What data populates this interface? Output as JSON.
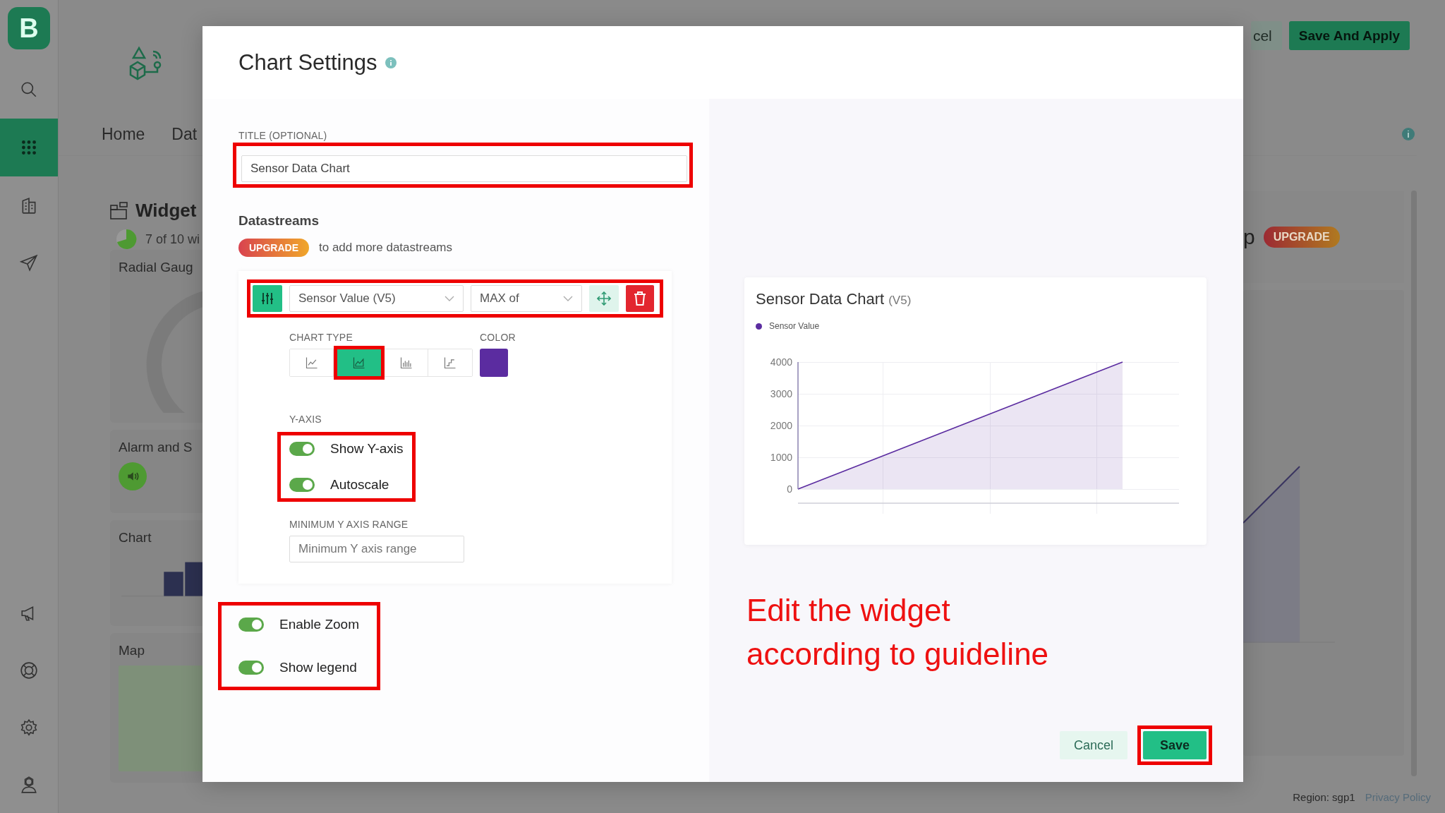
{
  "sidebar": {
    "logo": "B",
    "items": [
      {
        "kind": "search",
        "selected": false
      },
      {
        "kind": "grid",
        "selected": true
      },
      {
        "kind": "building",
        "selected": false
      },
      {
        "kind": "send",
        "selected": false
      },
      {
        "kind": "megaphone",
        "selected": false
      },
      {
        "kind": "lifebuoy",
        "selected": false
      },
      {
        "kind": "gear",
        "selected": false
      },
      {
        "kind": "user",
        "selected": false
      }
    ]
  },
  "header": {
    "buttons": [
      {
        "kind": "secondary",
        "label": "cel"
      },
      {
        "kind": "primary",
        "label": "Save And Apply"
      }
    ]
  },
  "nav": {
    "tabs": [
      {
        "label": "Home"
      },
      {
        "label": "Dat"
      }
    ]
  },
  "widgets": {
    "title": "Widget",
    "count": "7 of 10 wi",
    "cards": [
      {
        "kind": "gauge",
        "title": "Radial Gaug"
      },
      {
        "kind": "alarm",
        "title": "Alarm and S"
      },
      {
        "kind": "chart",
        "title": "Chart"
      },
      {
        "kind": "map",
        "title": "Map"
      }
    ]
  },
  "right_panel": {
    "card_text": "p",
    "badge": "UPGRADE"
  },
  "footer": {
    "region": "Region: sgp1",
    "link": "Privacy Policy"
  },
  "dialog": {
    "title": "Chart Settings",
    "title_field": {
      "label": "TITLE (OPTIONAL)",
      "value": "Sensor Data Chart",
      "highlighted": true
    },
    "datastreams": {
      "heading": "Datastreams",
      "upgrade_badge": "UPGRADE",
      "upgrade_note": "to add more datastreams",
      "row": {
        "datastream": "Sensor Value (V5)",
        "aggregation": "MAX of",
        "highlighted": true
      },
      "chart_type": {
        "label": "CHART TYPE",
        "options": [
          {
            "kind": "line",
            "selected": false,
            "highlighted": false
          },
          {
            "kind": "area",
            "selected": true,
            "highlighted": true
          },
          {
            "kind": "bar",
            "selected": false,
            "highlighted": false
          },
          {
            "kind": "step",
            "selected": false,
            "highlighted": false
          }
        ]
      },
      "color": {
        "label": "COLOR",
        "color": "#5b2ca0"
      },
      "y_axis": {
        "label": "Y-AXIS",
        "highlighted": true,
        "toggles": [
          {
            "label": "Show Y-axis",
            "on": true
          },
          {
            "label": "Autoscale",
            "on": true
          }
        ]
      },
      "min_range": {
        "label": "MINIMUM Y AXIS RANGE",
        "placeholder": "Minimum Y axis range"
      }
    },
    "options": {
      "highlighted": true,
      "toggles": [
        {
          "label": "Enable Zoom",
          "on": true
        },
        {
          "label": "Show legend",
          "on": true
        }
      ]
    },
    "preview": {
      "title": "Sensor Data Chart",
      "pin": "(V5)",
      "chart_data": {
        "type": "area",
        "yticks": [
          0,
          1000,
          2000,
          3000,
          4000
        ],
        "ylim": [
          0,
          4000
        ],
        "series": [
          {
            "name": "Sensor Value",
            "color": "#5b2ca0",
            "values": [
              0,
              4000
            ]
          }
        ]
      }
    },
    "annotation": "Edit the widget according to guideline",
    "buttons": {
      "cancel": {
        "label": "Cancel"
      },
      "save": {
        "label": "Save",
        "highlighted": true
      }
    }
  }
}
